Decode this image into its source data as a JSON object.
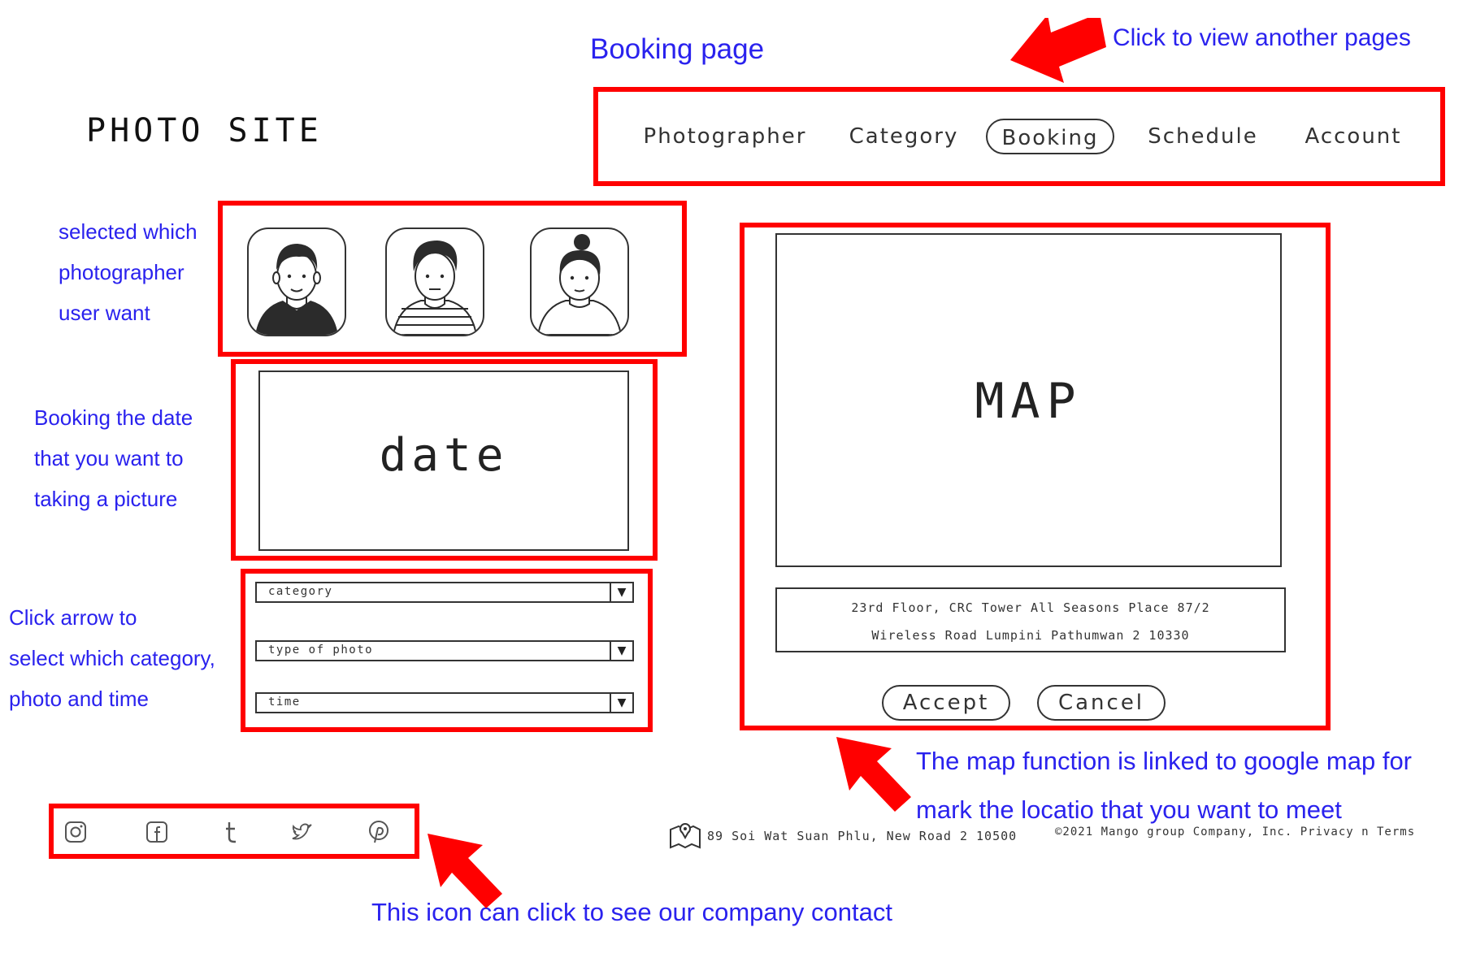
{
  "annotations": {
    "page_title": "Booking page",
    "nav_note": "Click to view another pages",
    "photographer_note": [
      "selected which",
      "photographer",
      "user want"
    ],
    "date_note": [
      "Booking the date",
      "that you want to",
      "taking a picture"
    ],
    "select_note": [
      "Click arrow to",
      "select which category,",
      "photo and time"
    ],
    "map_note": [
      "The map function is linked to google map for",
      "mark the locatio that you want to meet"
    ],
    "social_note": "This icon can click to see our company contact"
  },
  "header": {
    "logo": "PHOTO SITE",
    "nav": [
      {
        "label": "Photographer",
        "active": false
      },
      {
        "label": "Category",
        "active": false
      },
      {
        "label": "Booking",
        "active": true
      },
      {
        "label": "Schedule",
        "active": false
      },
      {
        "label": "Account",
        "active": false
      }
    ]
  },
  "photographers": [
    {
      "icon": "male-avatar-icon"
    },
    {
      "icon": "male-avatar-striped-icon"
    },
    {
      "icon": "female-avatar-icon"
    }
  ],
  "date_box": {
    "label": "date"
  },
  "selects": {
    "category": "category",
    "type_of_photo": "type of photo",
    "time": "time",
    "arrow": "▼"
  },
  "map": {
    "label": "MAP",
    "address_line1": "23rd Floor, CRC Tower All Seasons Place 87/2",
    "address_line2": "Wireless Road Lumpini Pathumwan 2 10330",
    "accept_label": "Accept",
    "cancel_label": "Cancel"
  },
  "footer": {
    "address": "89 Soi Wat Suan Phlu, New Road 2 10500",
    "copyright": "©2021 Mango group Company, Inc. Privacy n Terms",
    "socials": [
      "instagram-icon",
      "facebook-icon",
      "tumblr-icon",
      "twitter-icon",
      "pinterest-icon"
    ]
  },
  "colors": {
    "annotation": "#2a22ee",
    "highlight": "#ff0000"
  }
}
